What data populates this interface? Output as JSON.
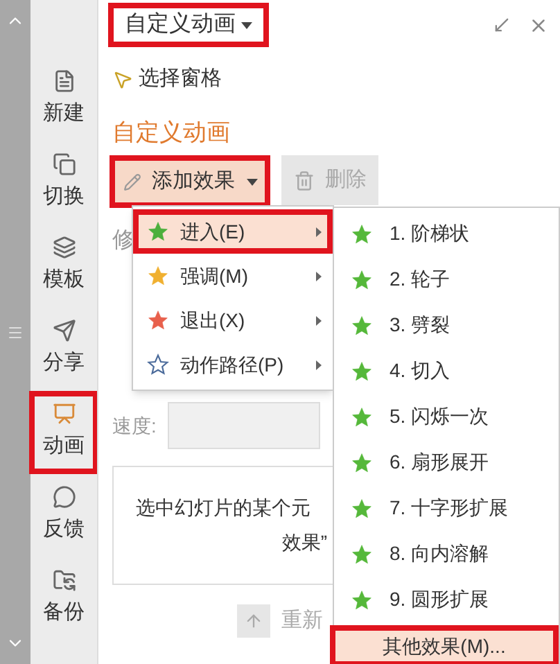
{
  "title_dropdown": {
    "label": "自定义动画",
    "highlighted": true
  },
  "sidebar": [
    {
      "label": "新建",
      "selected": false,
      "highlighted": false
    },
    {
      "label": "切换",
      "selected": false,
      "highlighted": false
    },
    {
      "label": "模板",
      "selected": false,
      "highlighted": false
    },
    {
      "label": "分享",
      "selected": false,
      "highlighted": false
    },
    {
      "label": "动画",
      "selected": true,
      "highlighted": true
    },
    {
      "label": "反馈",
      "selected": false,
      "highlighted": false
    },
    {
      "label": "备份",
      "selected": false,
      "highlighted": false
    }
  ],
  "selection_pane": "选择窗格",
  "section_title": "自定义动画",
  "add_effect": {
    "label": "添加效果",
    "highlighted": true
  },
  "delete": {
    "label": "删除",
    "disabled": true
  },
  "modify_label": "修",
  "speed_label": "速度:",
  "hint": [
    "选中幻灯片的某个元",
    "效果”"
  ],
  "reorder": "重新",
  "menu": [
    {
      "label": "进入(E)",
      "selected": true,
      "highlighted": true,
      "color": "#4caf3c",
      "kind": "filled"
    },
    {
      "label": "强调(M)",
      "selected": false,
      "highlighted": false,
      "color": "#f0b030",
      "kind": "filled"
    },
    {
      "label": "退出(X)",
      "selected": false,
      "highlighted": false,
      "color": "#e8604c",
      "kind": "filled"
    },
    {
      "label": "动作路径(P)",
      "selected": false,
      "highlighted": false,
      "color": "#4a6a9a",
      "kind": "outline"
    }
  ],
  "submenu": {
    "items": [
      "1. 阶梯状",
      "2. 轮子",
      "3. 劈裂",
      "4. 切入",
      "5. 闪烁一次",
      "6. 扇形展开",
      "7. 十字形扩展",
      "8. 向内溶解",
      "9. 圆形扩展"
    ],
    "more": {
      "label": "其他效果(M)...",
      "highlighted": true
    }
  }
}
